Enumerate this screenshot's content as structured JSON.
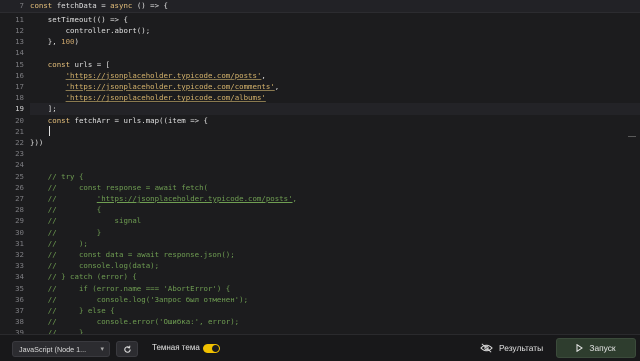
{
  "editor": {
    "sticky": {
      "line_number": "7",
      "tokens": [
        [
          "k",
          "const "
        ],
        [
          "v",
          "fetchData "
        ],
        [
          "p",
          "= "
        ],
        [
          "k",
          "async "
        ],
        [
          "p",
          "() => {"
        ]
      ]
    },
    "active_line": "19",
    "lines": [
      {
        "n": "11",
        "tokens": [
          [
            "p",
            "    setTimeout(() => {"
          ]
        ]
      },
      {
        "n": "12",
        "tokens": [
          [
            "p",
            "        controller.abort();"
          ]
        ]
      },
      {
        "n": "13",
        "tokens": [
          [
            "p",
            "    }, "
          ],
          [
            "n",
            "100"
          ],
          [
            "p",
            ")"
          ]
        ]
      },
      {
        "n": "14",
        "tokens": []
      },
      {
        "n": "15",
        "tokens": [
          [
            "k",
            "    const "
          ],
          [
            "v",
            "urls "
          ],
          [
            "p",
            "= ["
          ]
        ]
      },
      {
        "n": "16",
        "tokens": [
          [
            "p",
            "        "
          ],
          [
            "s",
            "'https://jsonplaceholder.typicode.com/posts'"
          ],
          [
            "p",
            ","
          ]
        ]
      },
      {
        "n": "17",
        "tokens": [
          [
            "p",
            "        "
          ],
          [
            "s",
            "'https://jsonplaceholder.typicode.com/comments'"
          ],
          [
            "p",
            ","
          ]
        ]
      },
      {
        "n": "18",
        "tokens": [
          [
            "p",
            "        "
          ],
          [
            "s",
            "'https://jsonplaceholder.typicode.com/albums'"
          ]
        ]
      },
      {
        "n": "19",
        "tokens": [
          [
            "p",
            "    ];"
          ]
        ]
      },
      {
        "n": "20",
        "tokens": [
          [
            "k",
            "    const "
          ],
          [
            "v",
            "fetchArr "
          ],
          [
            "p",
            "= urls.map((item => {"
          ]
        ]
      },
      {
        "n": "21",
        "tokens": []
      },
      {
        "n": "22",
        "tokens": [
          [
            "p",
            "}))"
          ]
        ]
      },
      {
        "n": "23",
        "tokens": []
      },
      {
        "n": "24",
        "tokens": []
      },
      {
        "n": "25",
        "tokens": [
          [
            "c",
            "    // try {"
          ]
        ]
      },
      {
        "n": "26",
        "tokens": [
          [
            "c",
            "    //     const response = await fetch("
          ]
        ]
      },
      {
        "n": "27",
        "tokens": [
          [
            "c",
            "    //         "
          ],
          [
            "cu",
            "'https://jsonplaceholder.typicode.com/posts'"
          ],
          [
            "c",
            ","
          ]
        ]
      },
      {
        "n": "28",
        "tokens": [
          [
            "c",
            "    //         {"
          ]
        ]
      },
      {
        "n": "29",
        "tokens": [
          [
            "c",
            "    //             signal"
          ]
        ]
      },
      {
        "n": "30",
        "tokens": [
          [
            "c",
            "    //         }"
          ]
        ]
      },
      {
        "n": "31",
        "tokens": [
          [
            "c",
            "    //     );"
          ]
        ]
      },
      {
        "n": "32",
        "tokens": [
          [
            "c",
            "    //     const data = await response.json();"
          ]
        ]
      },
      {
        "n": "33",
        "tokens": [
          [
            "c",
            "    //     console.log(data);"
          ]
        ]
      },
      {
        "n": "34",
        "tokens": [
          [
            "c",
            "    // } catch (error) {"
          ]
        ]
      },
      {
        "n": "35",
        "tokens": [
          [
            "c",
            "    //     if (error.name === 'AbortError') {"
          ]
        ]
      },
      {
        "n": "36",
        "tokens": [
          [
            "c",
            "    //         console.log('Запрос был отменен');"
          ]
        ]
      },
      {
        "n": "37",
        "tokens": [
          [
            "c",
            "    //     } else {"
          ]
        ]
      },
      {
        "n": "38",
        "tokens": [
          [
            "c",
            "    //         console.error('Ошибка:', error);"
          ]
        ]
      },
      {
        "n": "39",
        "tokens": [
          [
            "c",
            "    //     }"
          ]
        ]
      },
      {
        "n": "40",
        "tokens": [
          [
            "c",
            "    // }"
          ]
        ]
      }
    ]
  },
  "toolbar": {
    "language_value": "JavaScript (Node 1...",
    "reset_icon": "refresh-icon",
    "theme_label": "Темная тема",
    "theme_on": true,
    "results_label": "Результаты",
    "results_icon": "eye-off-icon",
    "run_label": "Запуск",
    "run_icon": "play-icon"
  }
}
